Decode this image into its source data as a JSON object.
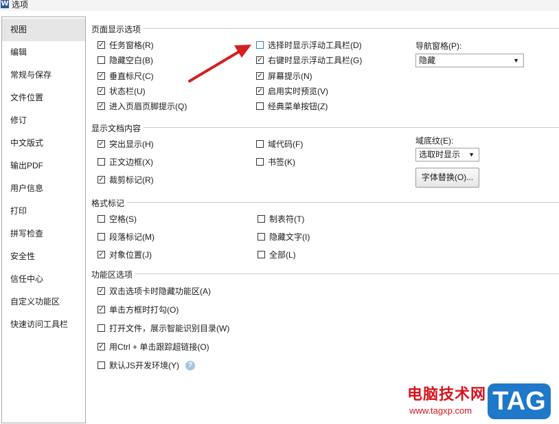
{
  "window": {
    "title": "选项",
    "app_icon": "W"
  },
  "sidebar": {
    "items": [
      {
        "label": "视图",
        "active": true
      },
      {
        "label": "编辑"
      },
      {
        "label": "常规与保存"
      },
      {
        "label": "文件位置"
      },
      {
        "label": "修订"
      },
      {
        "label": "中文版式"
      },
      {
        "label": "输出PDF"
      },
      {
        "label": "用户信息"
      },
      {
        "label": "打印"
      },
      {
        "label": "拼写检查"
      },
      {
        "label": "安全性"
      },
      {
        "label": "信任中心"
      },
      {
        "label": "自定义功能区"
      },
      {
        "label": "快速访问工具栏"
      }
    ]
  },
  "page_display": {
    "title": "页面显示选项",
    "left": [
      {
        "label": "任务窗格(R)",
        "checked": true
      },
      {
        "label": "隐藏空白(B)",
        "checked": false
      },
      {
        "label": "垂直标尺(C)",
        "checked": true
      },
      {
        "label": "状态栏(U)",
        "checked": true
      },
      {
        "label": "进入页眉页脚提示(Q)",
        "checked": true
      }
    ],
    "right": [
      {
        "label": "选择时显示浮动工具栏(D)",
        "checked": false
      },
      {
        "label": "右键时显示浮动工具栏(G)",
        "checked": true
      },
      {
        "label": "屏幕提示(N)",
        "checked": true
      },
      {
        "label": "启用实时预览(V)",
        "checked": true
      },
      {
        "label": "经典菜单按钮(Z)",
        "checked": false
      }
    ],
    "nav_pane_label": "导航窗格(P):",
    "nav_pane_value": "隐藏"
  },
  "doc_content": {
    "title": "显示文档内容",
    "left": [
      {
        "label": "突出显示(H)",
        "checked": true
      },
      {
        "label": "正文边框(X)",
        "checked": false
      },
      {
        "label": "裁剪标记(R)",
        "checked": true
      }
    ],
    "right": [
      {
        "label": "域代码(F)",
        "checked": false
      },
      {
        "label": "书签(K)",
        "checked": false
      }
    ],
    "field_shading_label": "域底纹(E):",
    "field_shading_value": "选取时显示",
    "font_replace_button": "字体替换(O)..."
  },
  "format_marks": {
    "title": "格式标记",
    "left": [
      {
        "label": "空格(S)",
        "checked": false
      },
      {
        "label": "段落标记(M)",
        "checked": false
      },
      {
        "label": "对象位置(J)",
        "checked": true
      }
    ],
    "right": [
      {
        "label": "制表符(T)",
        "checked": false
      },
      {
        "label": "隐藏文字(I)",
        "checked": false
      },
      {
        "label": "全部(L)",
        "checked": false
      }
    ]
  },
  "ribbon_options": {
    "title": "功能区选项",
    "items": [
      {
        "label": "双击选项卡时隐藏功能区(A)",
        "checked": true
      },
      {
        "label": "单击方框时打勾(O)",
        "checked": true
      },
      {
        "label": "打开文件，展示智能识别目录(W)",
        "checked": false
      },
      {
        "label": "用Ctrl + 单击跟踪超链接(O)",
        "checked": true
      },
      {
        "label": "默认JS开发环境(Y)",
        "checked": false
      }
    ],
    "help_icon": "?"
  },
  "watermark": {
    "site_name": "电脑技术网",
    "url": "www.tagxp.com",
    "tag": "TAG"
  },
  "colors": {
    "arrow": "#d42020",
    "tag_bg": "#1f78c8",
    "watermark_red": "#d6141b"
  }
}
